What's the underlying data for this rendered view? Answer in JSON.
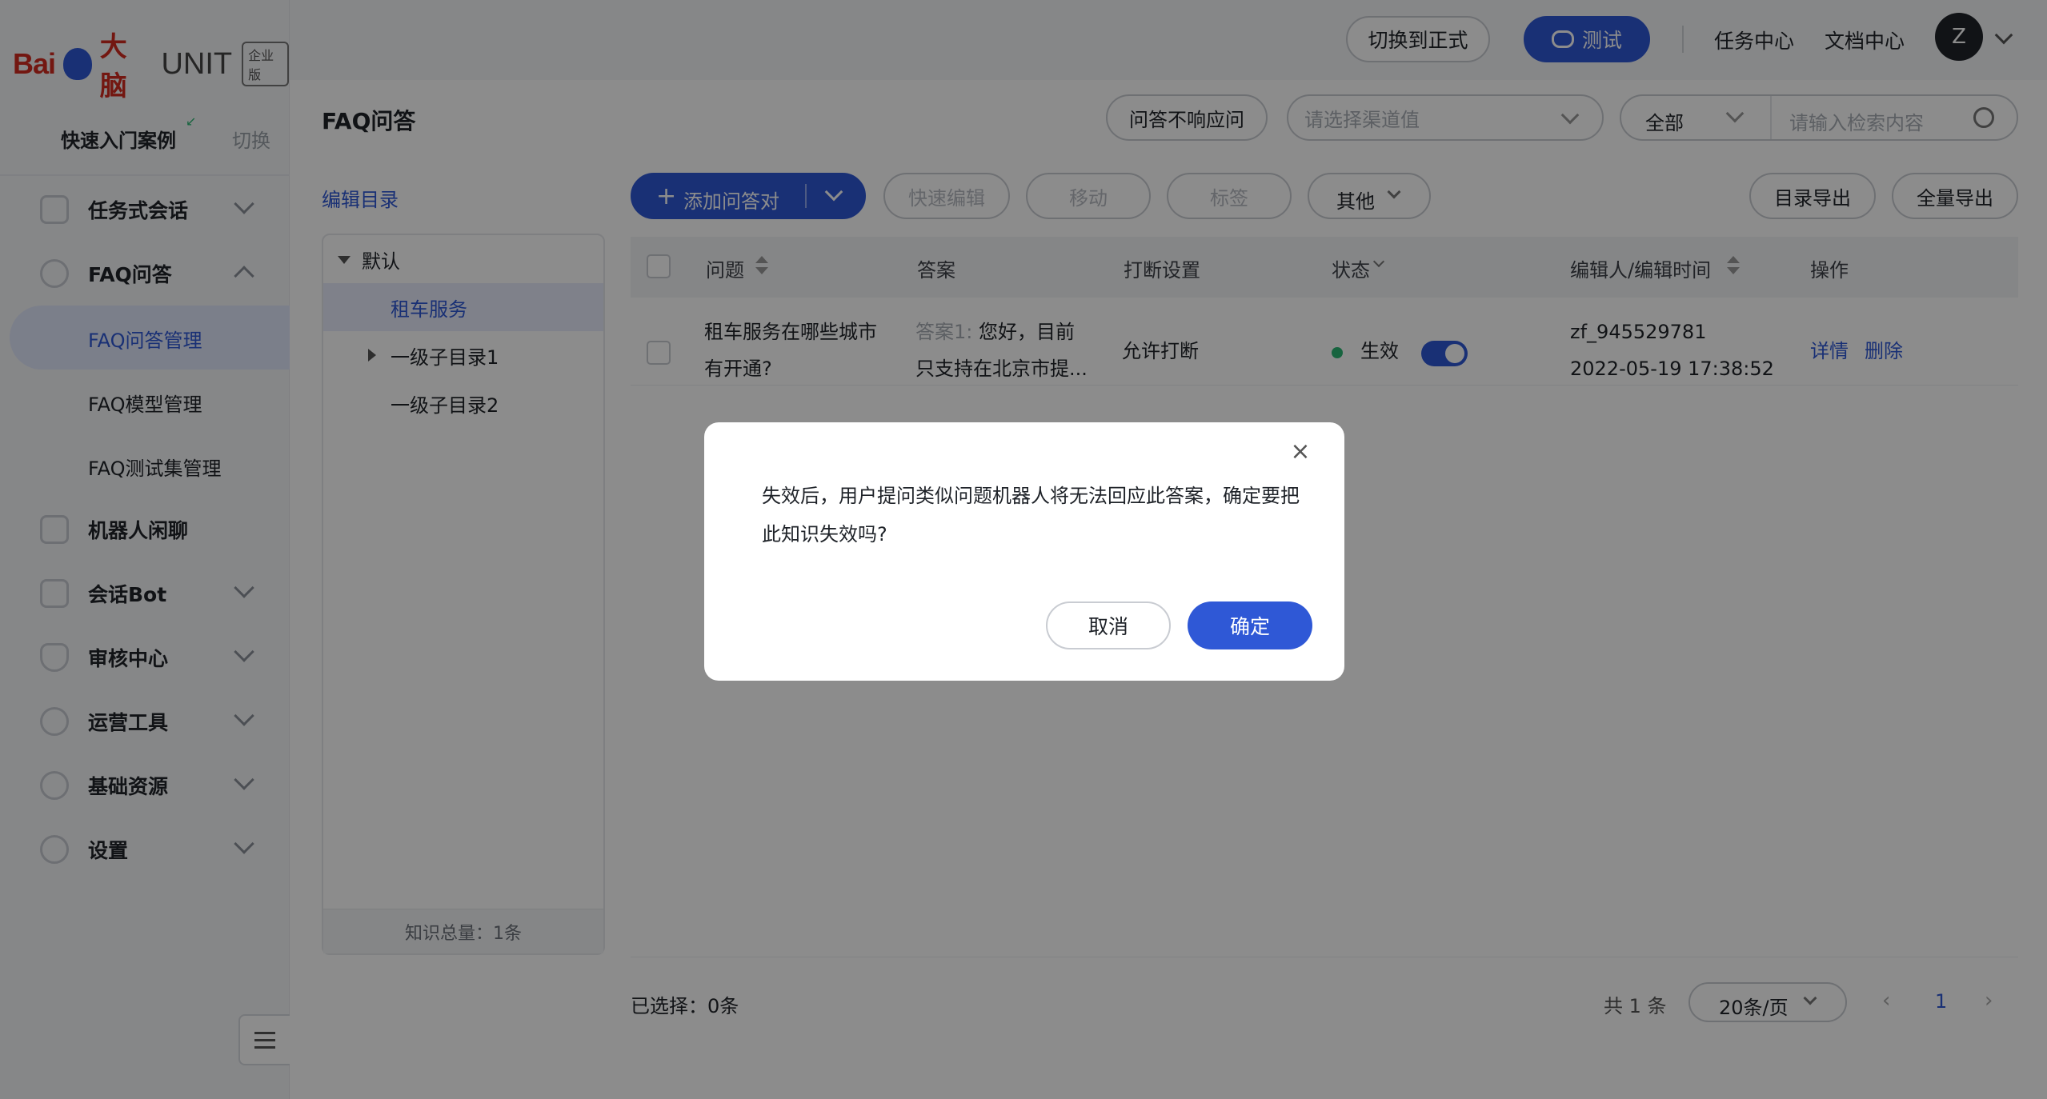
{
  "brand": {
    "baidu": "Bai",
    "du": "du",
    "brain": "大脑",
    "product": "UNIT",
    "edition": "企业版"
  },
  "quick_start": {
    "label": "快速入门案例",
    "switch": "切换"
  },
  "sidebar": {
    "items": [
      {
        "label": "任务式会话"
      },
      {
        "label": "FAQ问答"
      },
      {
        "label": "机器人闲聊"
      },
      {
        "label": "会话Bot"
      },
      {
        "label": "审核中心"
      },
      {
        "label": "运营工具"
      },
      {
        "label": "基础资源"
      },
      {
        "label": "设置"
      }
    ],
    "faq_sub": [
      {
        "label": "FAQ问答管理"
      },
      {
        "label": "FAQ模型管理"
      },
      {
        "label": "FAQ测试集管理"
      }
    ]
  },
  "topbar": {
    "switch_btn": "切换到正式",
    "test_btn": "测试",
    "task_center": "任务中心",
    "doc_center": "文档中心",
    "avatar_letter": "Z"
  },
  "page": {
    "title": "FAQ问答",
    "no_response_btn": "问答不响应问",
    "channel_placeholder": "请选择渠道值",
    "scope_select": "全部",
    "search_placeholder": "请输入检索内容"
  },
  "tree": {
    "edit_dir": "编辑目录",
    "root": "默认",
    "nodes": [
      "租车服务",
      "一级子目录1",
      "一级子目录2"
    ],
    "total": "知识总量：1条"
  },
  "toolbar": {
    "add_pair": "添加问答对",
    "quick_edit": "快速编辑",
    "move": "移动",
    "tag": "标签",
    "other": "其他",
    "export_dir": "目录导出",
    "export_all": "全量导出"
  },
  "table": {
    "headers": [
      "问题",
      "答案",
      "打断设置",
      "状态",
      "编辑人/编辑时间",
      "操作"
    ],
    "rows": [
      {
        "question_l1": "租车服务在哪些城市",
        "question_l2": "有开通?",
        "answer_prefix": "答案1:",
        "answer_l1": "您好，目前",
        "answer_l2": "只支持在北京市提...",
        "interrupt": "允许打断",
        "status": "生效",
        "editor": "zf_945529781",
        "time": "2022-05-19 17:38:52",
        "action_detail": "详情",
        "action_delete": "删除"
      }
    ]
  },
  "footer": {
    "selected": "已选择：0条",
    "total": "共 1 条",
    "page_size": "20条/页",
    "current_page": "1"
  },
  "modal": {
    "message": "失效后，用户提问类似问题机器人将无法回应此答案，确定要把此知识失效吗?",
    "cancel": "取消",
    "confirm": "确定"
  },
  "colors": {
    "primary": "#2f58d6",
    "brand_red": "#d12b1f",
    "success": "#2bb673"
  }
}
